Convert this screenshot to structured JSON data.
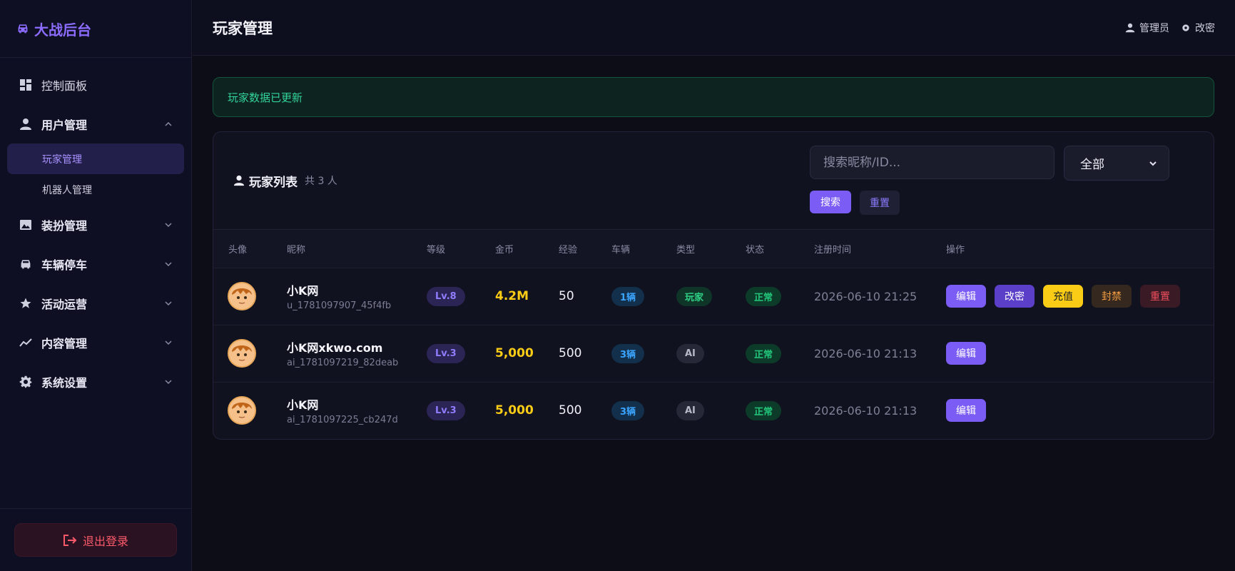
{
  "brand": {
    "title": "大战后台"
  },
  "sidebar": {
    "items": [
      {
        "label": "控制面板",
        "icon": "dashboard-icon"
      },
      {
        "label": "用户管理",
        "icon": "user-icon",
        "expanded": true,
        "children": [
          {
            "label": "玩家管理",
            "active": true
          },
          {
            "label": "机器人管理"
          }
        ]
      },
      {
        "label": "装扮管理",
        "icon": "image-icon"
      },
      {
        "label": "车辆停车",
        "icon": "car-icon"
      },
      {
        "label": "活动运营",
        "icon": "star-icon"
      },
      {
        "label": "内容管理",
        "icon": "trend-icon"
      },
      {
        "label": "系统设置",
        "icon": "gear-icon"
      }
    ],
    "logout_label": "退出登录"
  },
  "header": {
    "title": "玩家管理",
    "admin_label": "管理员",
    "change_pwd_label": "改密"
  },
  "alert": {
    "text": "玩家数据已更新"
  },
  "card": {
    "title": "玩家列表",
    "count": "共 3 人",
    "search_placeholder": "搜索昵称/ID...",
    "select_value": "全部",
    "search_btn": "搜索",
    "reset_btn": "重置"
  },
  "table": {
    "headers": [
      "头像",
      "昵称",
      "等级",
      "金币",
      "经验",
      "车辆",
      "类型",
      "状态",
      "注册时间",
      "操作"
    ],
    "rows": [
      {
        "nick": "小K网",
        "uid": "u_1781097907_45f4fb",
        "level": "Lv.8",
        "gold": "4.2M",
        "exp": "50",
        "cars": "1辆",
        "type": "玩家",
        "status": "正常",
        "date": "2026-06-10 21:25",
        "ops": [
          "编辑",
          "改密",
          "充值",
          "封禁",
          "重置"
        ]
      },
      {
        "nick": "小K网xkwo.com",
        "uid": "ai_1781097219_82deab",
        "level": "Lv.3",
        "gold": "5,000",
        "exp": "500",
        "cars": "3辆",
        "type": "AI",
        "status": "正常",
        "date": "2026-06-10 21:13",
        "ops": [
          "编辑"
        ]
      },
      {
        "nick": "小K网",
        "uid": "ai_1781097225_cb247d",
        "level": "Lv.3",
        "gold": "5,000",
        "exp": "500",
        "cars": "3辆",
        "type": "AI",
        "status": "正常",
        "date": "2026-06-10 21:13",
        "ops": [
          "编辑"
        ]
      }
    ]
  },
  "colors": {
    "accent": "#7b5cf5",
    "gold": "#facc15",
    "success": "#22c77a",
    "danger": "#f04f5e"
  }
}
